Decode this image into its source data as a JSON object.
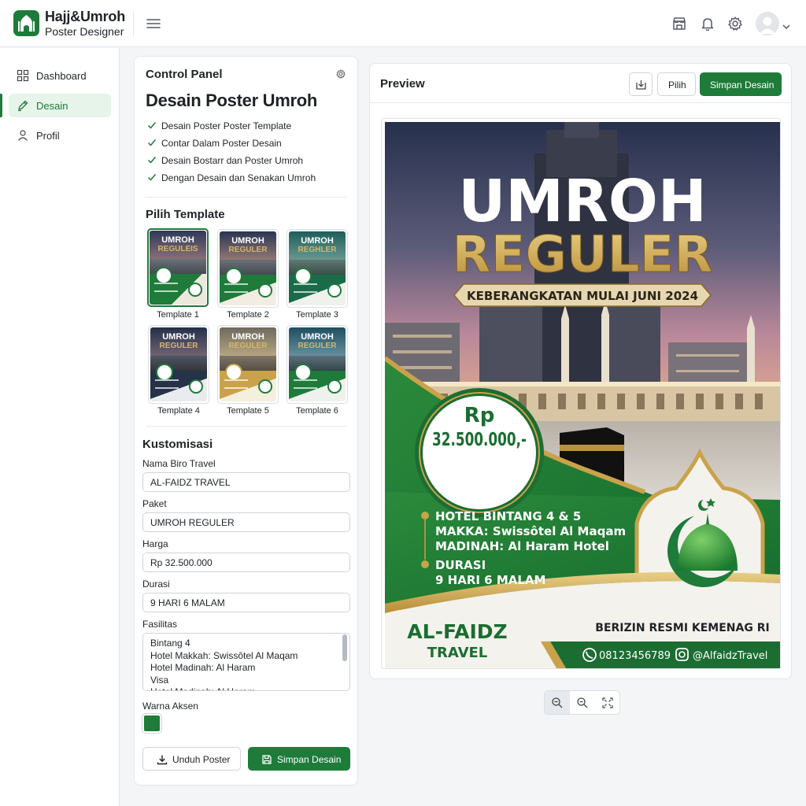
{
  "app": {
    "name": "Hajj&Umroh",
    "subtitle": "Poster Designer"
  },
  "header": {
    "icons": [
      "shop-icon",
      "bell-icon",
      "gear-icon",
      "user-avatar",
      "chevron-down-icon"
    ]
  },
  "sidebar": {
    "items": [
      {
        "label": "Dashboard",
        "icon": "grid-icon",
        "active": false
      },
      {
        "label": "Desain",
        "icon": "pen-icon",
        "active": true
      },
      {
        "label": "Profil",
        "icon": "user-icon",
        "active": false
      }
    ]
  },
  "control_panel": {
    "title": "Control Panel",
    "heading": "Desain Poster Umroh",
    "checklist": [
      "Desain Poster Poster Template",
      "Contar Dalam Poster Desain",
      "Desain Bostarr dan Poster Umroh",
      "Dengan Desain dan Senakan Umroh"
    ],
    "template_section": "Pilih Template",
    "templates": [
      {
        "label": "Template 1",
        "selected": true,
        "t1": "UMROH",
        "t2": "REGULEIS"
      },
      {
        "label": "Template 2",
        "selected": false,
        "t1": "UMROH",
        "t2": "REGULER"
      },
      {
        "label": "Template 3",
        "selected": false,
        "t1": "UMROH",
        "t2": "REGHLER"
      },
      {
        "label": "Template 4",
        "selected": false,
        "t1": "UMROH",
        "t2": "REGULER"
      },
      {
        "label": "Template 5",
        "selected": false,
        "t1": "UMROH",
        "t2": "REGULER"
      },
      {
        "label": "Template 6",
        "selected": false,
        "t1": "UMROH",
        "t2": "REGULER"
      }
    ],
    "customize_section": "Kustomisasi",
    "fields": {
      "travel_name": {
        "label": "Nama Biro Travel",
        "value": "AL-FAIDZ TRAVEL"
      },
      "package": {
        "label": "Paket",
        "value": "UMROH REGULER"
      },
      "price": {
        "label": "Harga",
        "value": "Rp 32.500.000"
      },
      "duration": {
        "label": "Durasi",
        "value": "9 HARI 6 MALAM"
      },
      "facilities": {
        "label": "Fasilitas",
        "value": "Bintang 4\nHotel Makkah: Swissôtel Al Maqam\nHotel Madinah: Al Haram\nVisa\nHotel Madinah: Al Haram"
      }
    },
    "accent": {
      "label": "Warna Aksen",
      "color": "#1e7b3a"
    },
    "download_label": "Unduh Poster",
    "save_label": "Simpan Desain"
  },
  "preview": {
    "title": "Preview",
    "pick_label": "Pilih",
    "save_label": "Simpan Desain",
    "poster": {
      "title1": "UMROH",
      "title2": "REGULER",
      "departure": "KEBERANGKATAN MULAI JUNI 2024",
      "price_prefix": "Rp",
      "price": "32.500.000,-",
      "hotel": [
        "HOTEL BINTANG 4 & 5",
        "MAKKA: Swissôtel Al Maqam",
        "MADINAH: Al Haram Hotel"
      ],
      "duration": [
        "DURASI",
        "9 HARI 6 MALAM"
      ],
      "brand1": "AL-FAIDZ",
      "brand2": "TRAVEL",
      "license": "BERIZIN RESMI KEMENAG RI",
      "phone": "08123456789",
      "instagram": "@AlfaidzTravel"
    }
  },
  "zoom": {
    "icons": [
      "zoom-in-icon",
      "zoom-out-icon",
      "fit-screen-icon"
    ]
  },
  "colors": {
    "primary": "#1e7b3a",
    "gold": "#c9a24a",
    "sky_top": "#2a3553",
    "sky_bottom": "#d9a48c"
  }
}
